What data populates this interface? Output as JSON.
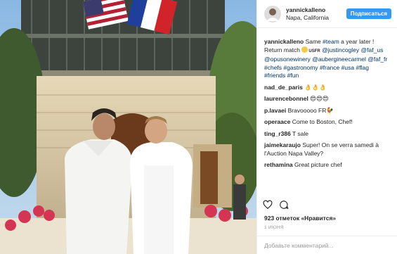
{
  "header": {
    "username": "yannickalleno",
    "location": "Napa, California",
    "follow_label": "Подписаться"
  },
  "caption": {
    "username": "yannickalleno",
    "text_1": " Same ",
    "tag_team": "#team",
    "text_2": " a year later ! Return match ",
    "emoji_label": "USFR",
    "mention_1": "@justincogley",
    "mention_2": "@faf_us",
    "mention_3": "@opusonewinery",
    "mention_4": "@aubergineecarmel",
    "mention_5": "@faf_fr",
    "hashtags": [
      "#chefs",
      "#gastronomy",
      "#france",
      "#usa",
      "#flag",
      "#friends",
      "#fun"
    ]
  },
  "comments": [
    {
      "user": "nad_de_paris",
      "text": "👌👌👌"
    },
    {
      "user": "laurencebonnel",
      "text": "😍😍😍"
    },
    {
      "user": "p.lavaei",
      "text": "Bravooooo FR🐓"
    },
    {
      "user": "operaace",
      "text": "Come to Boston, Chef!"
    },
    {
      "user": "ting_r386",
      "text": "T sale"
    },
    {
      "user": "jaimekaraujo",
      "text": "Super! On se verra samedi à l'Auction Napa Valley?"
    },
    {
      "user": "rethamina",
      "text": "Great picture chef"
    }
  ],
  "actions": {
    "like_icon": "heart-icon",
    "comment_icon": "comment-icon"
  },
  "likes_text": "923 отметок «Нравится»",
  "date_text": "1 июня",
  "add_comment_placeholder": "Добавьте комментарий...",
  "colors": {
    "follow_bg": "#3897f0",
    "link": "#003569",
    "sky": "#8ab8e3"
  }
}
